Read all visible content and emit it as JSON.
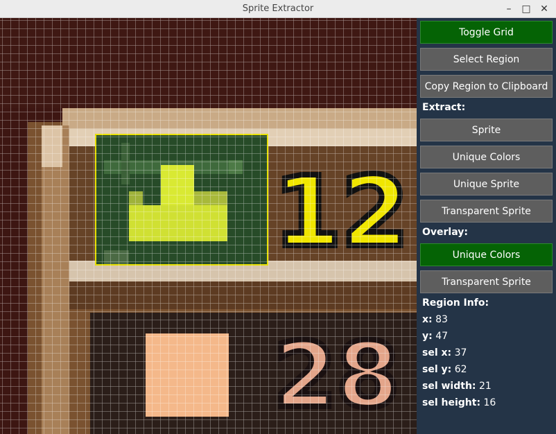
{
  "window": {
    "title": "Sprite Extractor",
    "minimize_icon": "minimize-icon",
    "maximize_icon": "maximize-icon",
    "close_icon": "close-icon"
  },
  "canvas": {
    "grid_visible": true,
    "counter_top": "12",
    "counter_bottom": "28",
    "colors": {
      "selection": "#e7e000",
      "selection_fill": "#274b28",
      "sprite": "#d9e933",
      "digits_top": "#f0e600",
      "digits_bottom": "#f0b48c"
    }
  },
  "sidebar": {
    "toggle_grid": "Toggle Grid",
    "select_region": "Select Region",
    "copy_region": "Copy Region to Clipboard",
    "extract_label": "Extract:",
    "extract_sprite": "Sprite",
    "extract_unique_colors": "Unique Colors",
    "extract_unique_sprite": "Unique Sprite",
    "extract_transparent_sprite": "Transparent Sprite",
    "overlay_label": "Overlay:",
    "overlay_unique_colors": "Unique Colors",
    "overlay_transparent_sprite": "Transparent Sprite",
    "region_info_label": "Region Info:",
    "info": {
      "x_label": "x:",
      "x": "83",
      "y_label": "y:",
      "y": "47",
      "sel_x_label": "sel x:",
      "sel_x": "37",
      "sel_y_label": "sel y:",
      "sel_y": "62",
      "sel_width_label": "sel width:",
      "sel_width": "21",
      "sel_height_label": "sel height:",
      "sel_height": "16"
    },
    "colors": {
      "active_button": "#056305",
      "button": "#5e5e5e",
      "panel": "#243447"
    }
  }
}
